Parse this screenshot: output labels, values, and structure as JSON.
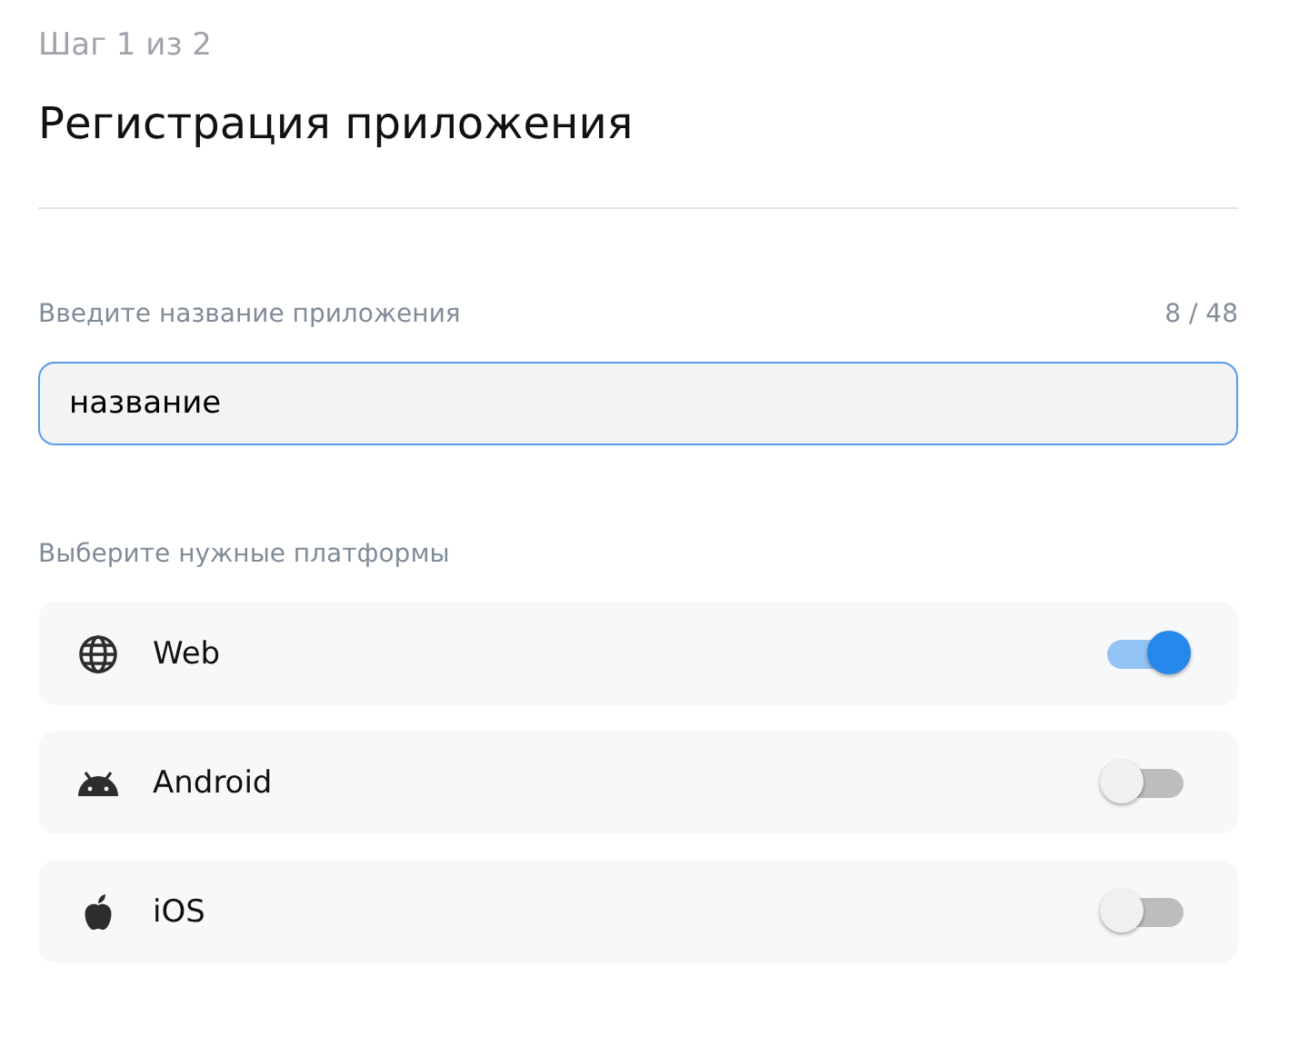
{
  "step": "Шаг 1 из 2",
  "title": "Регистрация приложения",
  "name_field": {
    "label": "Введите название приложения",
    "counter": "8 / 48",
    "value": "название"
  },
  "platforms_label": "Выберите нужные платформы",
  "platforms": [
    {
      "kind": "globe",
      "name": "Web",
      "on": true
    },
    {
      "kind": "android",
      "name": "Android",
      "on": false
    },
    {
      "kind": "apple",
      "name": "iOS",
      "on": false
    }
  ]
}
